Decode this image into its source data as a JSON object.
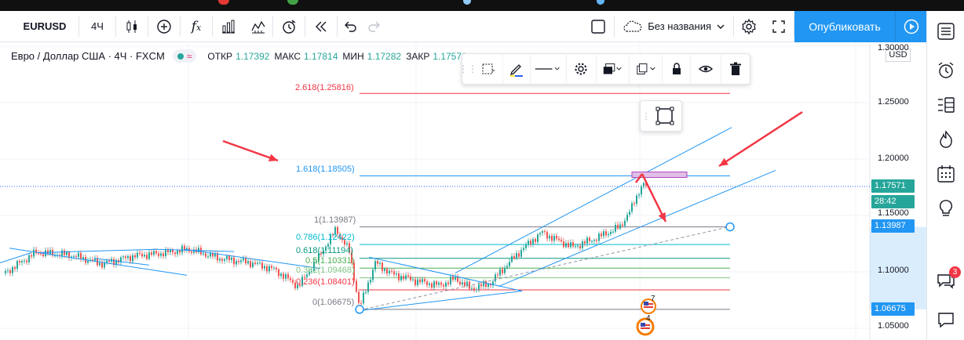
{
  "toolbar": {
    "symbol": "EURUSD",
    "interval": "4Ч",
    "layout_name": "Без названия",
    "publish_label": "Опубликовать"
  },
  "legend": {
    "title": "Евро / Доллар США · 4Ч · FXCM",
    "open_label": "ОТКР",
    "open": "1.17392",
    "high_label": "МАКС",
    "high": "1.17814",
    "low_label": "МИН",
    "low": "1.17282",
    "close_label": "ЗАКР",
    "close": "1.17571",
    "pill_icon": "≈"
  },
  "price_axis": {
    "currency": "USD",
    "ticks": [
      "1.30000",
      "1.25000",
      "1.20000",
      "1.15000",
      "1.10000",
      "1.05000"
    ],
    "current_price": "1.17571",
    "countdown": "28:42",
    "drawing_high": "1.13987",
    "drawing_low": "1.06675"
  },
  "fib_levels": [
    {
      "ratio": "2.618",
      "price": "1.25816",
      "color": "#f23645"
    },
    {
      "ratio": "1.618",
      "price": "1.18505",
      "color": "#2196f3"
    },
    {
      "ratio": "1",
      "price": "1.13987",
      "color": "#787b86"
    },
    {
      "ratio": "0.786",
      "price": "1.12422",
      "color": "#00bcd4"
    },
    {
      "ratio": "0.618",
      "price": "1.11194",
      "color": "#089981"
    },
    {
      "ratio": "0.5",
      "price": "1.10331",
      "color": "#4caf50"
    },
    {
      "ratio": "0.382",
      "price": "1.09468",
      "color": "#81c784"
    },
    {
      "ratio": "0.236",
      "price": "1.08401",
      "color": "#f23645"
    },
    {
      "ratio": "0",
      "price": "1.06675",
      "color": "#787b86"
    }
  ],
  "events": {
    "event_count_1": "7",
    "event_count_2": "4"
  },
  "right_sidebar": {
    "chat_badge": "3"
  },
  "colors": {
    "up": "#26a69a",
    "down": "#ef5350",
    "accent": "#2196f3",
    "arrow": "#f23645",
    "highlight": "#e1bee7"
  }
}
